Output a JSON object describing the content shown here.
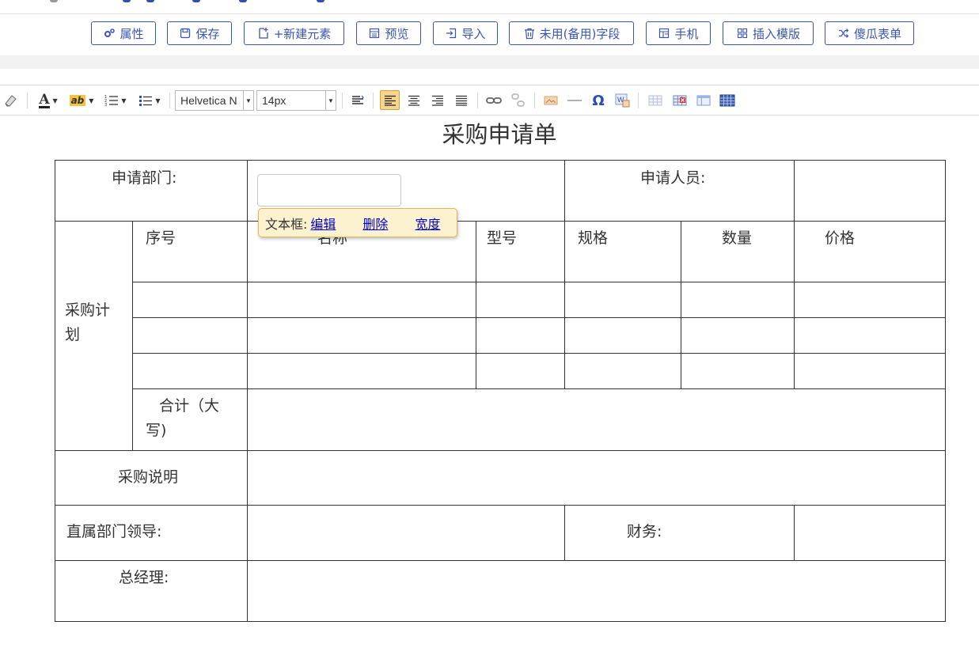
{
  "toolbar_buttons": [
    {
      "label": "属性",
      "icon": "gear-icon"
    },
    {
      "label": "保存",
      "icon": "save-icon"
    },
    {
      "label": "+新建元素",
      "icon": "new-doc-icon"
    },
    {
      "label": "预览",
      "icon": "preview-icon"
    },
    {
      "label": "导入",
      "icon": "import-icon"
    },
    {
      "label": "未用(备用)字段",
      "icon": "trash-icon"
    },
    {
      "label": "手机",
      "icon": "mobile-layout-icon"
    },
    {
      "label": "插入模版",
      "icon": "template-grid-icon"
    },
    {
      "label": "傻瓜表单",
      "icon": "shuffle-icon"
    }
  ],
  "editor": {
    "font_family": "Helvetica N",
    "font_size": "14px",
    "icons": [
      "eraser-icon",
      "font-color-icon",
      "highlight-icon",
      "ordered-list-icon",
      "unordered-list-icon",
      "line-height-icon",
      "align-left-icon",
      "align-center-icon",
      "align-right-icon",
      "align-justify-icon",
      "link-icon",
      "unlink-icon",
      "image-icon",
      "horizontal-rule-icon",
      "special-char-icon",
      "word-image-icon",
      "table-icon",
      "delete-table-icon",
      "table-props-icon",
      "insert-table-icon"
    ]
  },
  "form": {
    "title": "采购申请单",
    "dept_label": "申请部门:",
    "applicant_label": "申请人员:",
    "plan_label": "采购计划",
    "col_seq": "序号",
    "col_name": "名称",
    "col_model": "型号",
    "col_spec": "规格",
    "col_qty": "数量",
    "col_price": "价格",
    "total_label": "合计（大写)",
    "desc_label": "采购说明",
    "leader_label": "直属部门领导:",
    "finance_label": "财务:",
    "gm_label": "总经理:"
  },
  "popup": {
    "prefix": "文本框:",
    "edit": "编辑",
    "delete": "删除",
    "width": "宽度"
  },
  "colors": {
    "accent": "#3a55b4",
    "popup_bg": "#fdf2cf",
    "active_align": "#f7d48c"
  }
}
